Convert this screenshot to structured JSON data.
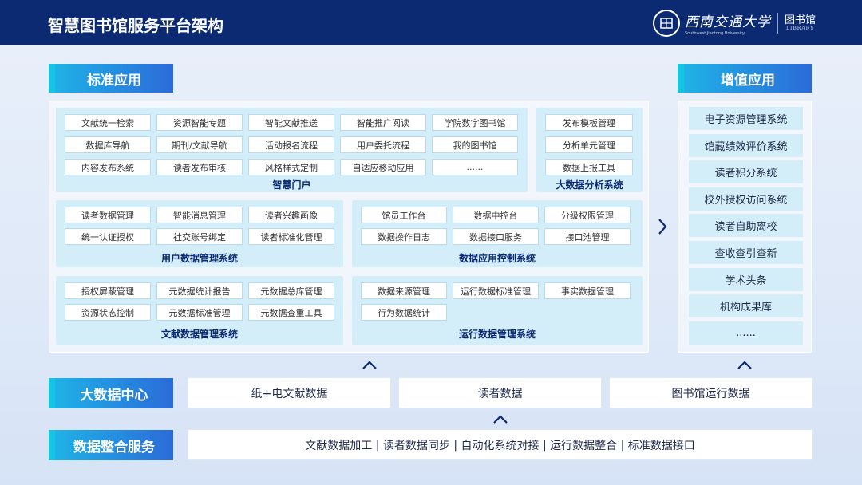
{
  "header": {
    "title": "智慧图书馆服务平台架构",
    "school_name": "西南交通大学",
    "school_sub": "Southwest Jiaotong University",
    "library_name": "图书馆",
    "library_en": "LIBRARY"
  },
  "standard_apps": {
    "label": "标准应用",
    "portal": {
      "title": "智慧门户",
      "items": [
        "文献统一检索",
        "资源智能专题",
        "智能文献推送",
        "智能推广阅读",
        "学院数字图书馆",
        "数据库导航",
        "期刊/文献导航",
        "活动报名流程",
        "用户委托流程",
        "我的图书馆",
        "内容发布系统",
        "读者发布审核",
        "风格样式定制",
        "自适应移动应用",
        "......"
      ]
    },
    "bigdata_analysis": {
      "title": "大数据分析系统",
      "items": [
        "发布模板管理",
        "分析单元管理",
        "数据上报工具"
      ]
    },
    "user_data": {
      "title": "用户数据管理系统",
      "items": [
        "读者数据管理",
        "智能消息管理",
        "读者兴趣画像",
        "统一认证授权",
        "社交账号绑定",
        "读者标准化管理"
      ]
    },
    "data_app_control": {
      "title": "数据应用控制系统",
      "items": [
        "馆员工作台",
        "数据中控台",
        "分级权限管理",
        "数据操作日志",
        "数据接口服务",
        "接口池管理"
      ]
    },
    "doc_data": {
      "title": "文献数据管理系统",
      "items": [
        "授权屏蔽管理",
        "元数据统计报告",
        "元数据总库管理",
        "资源状态控制",
        "元数据标准管理",
        "元数据查重工具"
      ]
    },
    "ops_data": {
      "title": "运行数据管理系统",
      "items": [
        "数据来源管理",
        "运行数据标准管理",
        "事实数据管理",
        "行为数据统计"
      ]
    }
  },
  "value_apps": {
    "label": "增值应用",
    "items": [
      "电子资源管理系统",
      "馆藏绩效评价系统",
      "读者积分系统",
      "校外授权访问系统",
      "读者自助离校",
      "查收查引查新",
      "学术头条",
      "机构成果库",
      "......"
    ]
  },
  "bigdata_center": {
    "label": "大数据中心",
    "items": [
      "纸+电文献数据",
      "读者数据",
      "图书馆运行数据"
    ]
  },
  "integration": {
    "label": "数据整合服务",
    "text": "文献数据加工 | 读者数据同步 | 自动化系统对接 | 运行数据整合 | 标准数据接口"
  },
  "colors": {
    "header_bg": "#0b2a72",
    "tag_gradient_start": "#1fb2e6",
    "tag_gradient_end": "#2b6bd9",
    "group_bg": "#d3eef8",
    "title_text": "#0b2a72"
  }
}
